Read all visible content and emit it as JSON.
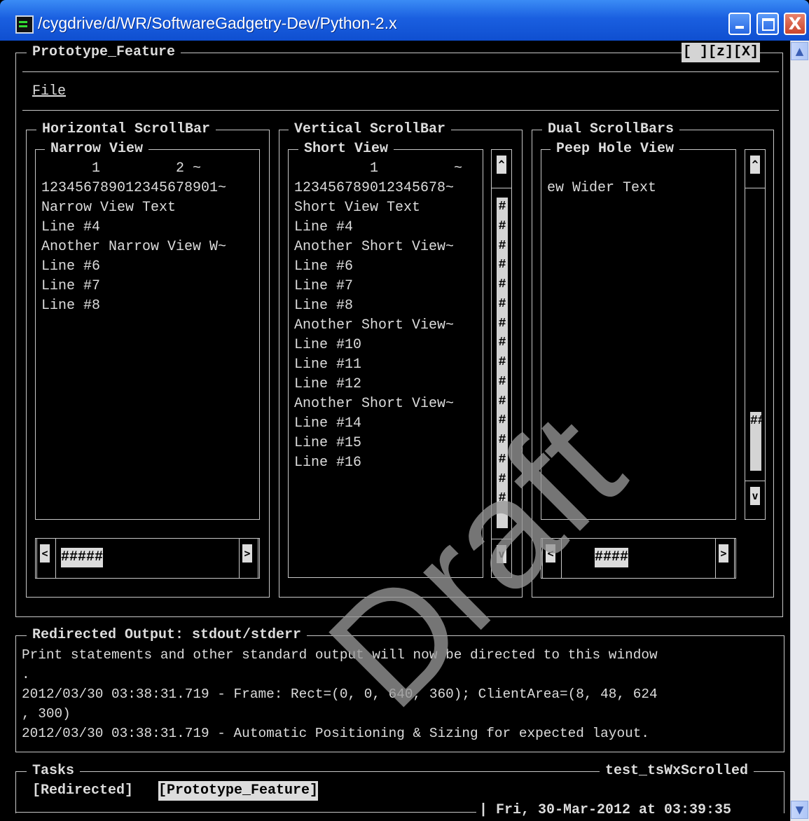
{
  "window": {
    "title": "/cygdrive/d/WR/SoftwareGadgetry-Dev/Python-2.x",
    "close_glyph": "X"
  },
  "frame": {
    "title": "Prototype_Feature",
    "controls": "[ ][z][X]"
  },
  "menu": {
    "file": "File"
  },
  "panels": {
    "horizontal": {
      "title": "Horizontal ScrollBar",
      "view_title": "Narrow View",
      "lines": [
        "      1         2 ~",
        "123456789012345678901~",
        "Narrow View Text",
        "Line #4",
        "Another Narrow View W~",
        "Line #6",
        "Line #7",
        "Line #8"
      ],
      "left_arrow": "<",
      "right_arrow": ">",
      "thumb": "#####"
    },
    "vertical": {
      "title": "Vertical ScrollBar",
      "view_title": "Short View",
      "lines": [
        "         1         ~",
        "123456789012345678~",
        "Short View Text",
        "Line #4",
        "Another Short View~",
        "Line #6",
        "Line #7",
        "Line #8",
        "Another Short View~",
        "Line #10",
        "Line #11",
        "Line #12",
        "Another Short View~",
        "Line #14",
        "Line #15",
        "Line #16"
      ],
      "up_arrow": "^",
      "down_arrow": "v",
      "thumb": "################"
    },
    "dual": {
      "title": "Dual ScrollBars",
      "view_title": "Peep Hole View",
      "lines": [
        "",
        "ew Wider Text"
      ],
      "up_arrow": "^",
      "down_arrow": "v",
      "vthumb": "###",
      "left_arrow": "<",
      "right_arrow": ">",
      "hthumb": "####"
    }
  },
  "output": {
    "title": "Redirected Output: stdout/stderr",
    "lines": [
      "Print statements and other standard output will now be directed to this window",
      ".",
      "2012/03/30 03:38:31.719 - Frame: Rect=(0, 0, 640, 360); ClientArea=(8, 48, 624",
      ", 300)",
      "2012/03/30 03:38:31.719 - Automatic Positioning & Sizing for expected layout."
    ]
  },
  "tasks": {
    "title": "Tasks",
    "app_name": "test_tsWxScrolled",
    "items": [
      "[Redirected]",
      "[Prototype_Feature]"
    ],
    "status": "| Fri, 30-Mar-2012 at 03:39:35"
  },
  "watermark": "Draft"
}
